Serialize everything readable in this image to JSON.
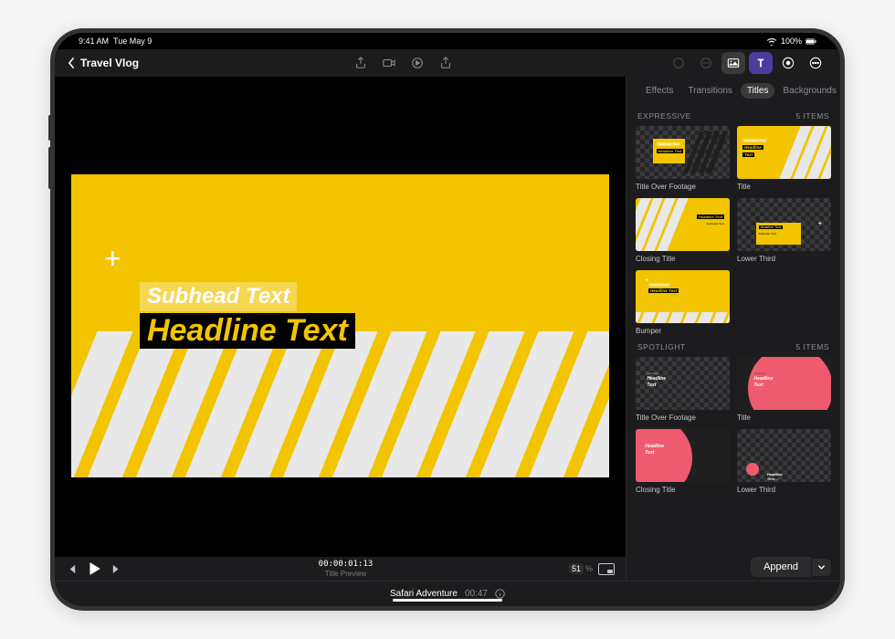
{
  "status": {
    "time": "9:41 AM",
    "date": "Tue May 9",
    "battery": "100%"
  },
  "header": {
    "back_label": "Travel Vlog"
  },
  "preview": {
    "subhead": "Subhead Text",
    "headline": "Headline Text",
    "plus": "+"
  },
  "transport": {
    "timecode": "00:00:01:13",
    "label": "Title Preview",
    "zoom_value": "51",
    "zoom_unit": "%"
  },
  "panel_tabs": {
    "effects": "Effects",
    "transitions": "Transitions",
    "titles": "Titles",
    "backgrounds": "Backgrounds"
  },
  "sections": {
    "expressive": {
      "name": "EXPRESSIVE",
      "count": "5 Items",
      "items": [
        {
          "label": "Title Over Footage"
        },
        {
          "label": "Title"
        },
        {
          "label": "Closing Title"
        },
        {
          "label": "Lower Third"
        },
        {
          "label": "Bumper"
        }
      ]
    },
    "spotlight": {
      "name": "SPOTLIGHT",
      "count": "5 Items",
      "items": [
        {
          "label": "Title Over Footage"
        },
        {
          "label": "Title"
        },
        {
          "label": "Closing Title"
        },
        {
          "label": "Lower Third"
        }
      ]
    }
  },
  "thumb_text": {
    "sub": "Subhead Text",
    "hl": "Headline Text",
    "hl_split1": "Headline",
    "hl_split2": "Text"
  },
  "footer_action": "Append",
  "project": {
    "name": "Safari Adventure",
    "duration": "00:47"
  }
}
